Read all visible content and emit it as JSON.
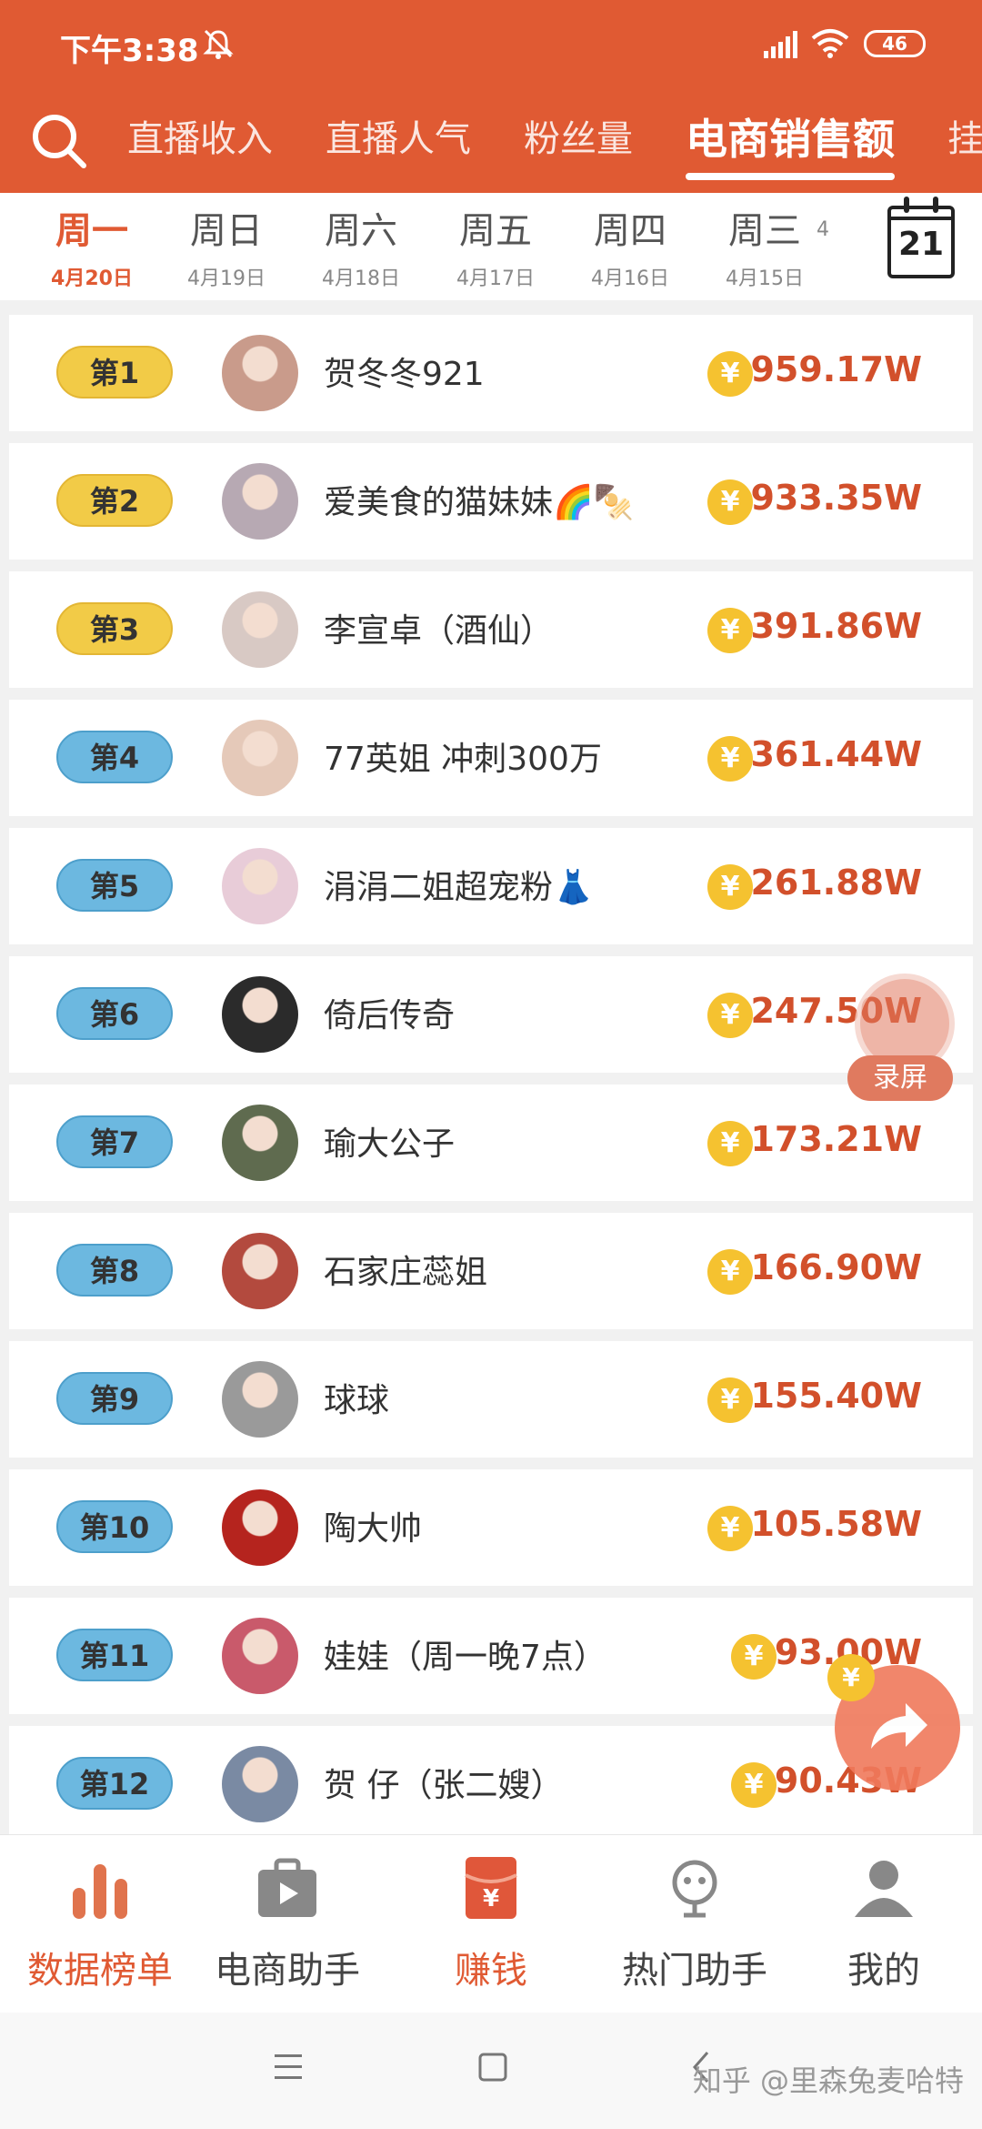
{
  "status": {
    "time": "下午3:38",
    "battery": "46"
  },
  "tabs": [
    {
      "label": "直播收入",
      "active": false
    },
    {
      "label": "直播人气",
      "active": false
    },
    {
      "label": "粉丝量",
      "active": false
    },
    {
      "label": "电商销售额",
      "active": true
    },
    {
      "label": "挂",
      "active": false
    }
  ],
  "days": [
    {
      "day": "周一",
      "date": "4月20日",
      "active": true
    },
    {
      "day": "周日",
      "date": "4月19日"
    },
    {
      "day": "周六",
      "date": "4月18日"
    },
    {
      "day": "周五",
      "date": "4月17日"
    },
    {
      "day": "周四",
      "date": "4月16日"
    },
    {
      "day": "周三",
      "date": "4月15日"
    },
    {
      "day": "",
      "date": "4"
    }
  ],
  "calendar": {
    "num": "21"
  },
  "rows": [
    {
      "rank": "第1",
      "name": "贺冬冬921",
      "amount": "959.17W",
      "tier": "gold",
      "avatar": "#c99b8b"
    },
    {
      "rank": "第2",
      "name": "爱美食的猫妹妹🌈🍢",
      "amount": "933.35W",
      "tier": "gold",
      "avatar": "#b7a9b3"
    },
    {
      "rank": "第3",
      "name": "李宣卓（酒仙）",
      "amount": "391.86W",
      "tier": "gold",
      "avatar": "#d8c9c4"
    },
    {
      "rank": "第4",
      "name": "77英姐 冲刺300万",
      "amount": "361.44W",
      "tier": "blue",
      "avatar": "#e5c9b9"
    },
    {
      "rank": "第5",
      "name": "涓涓二姐超宠粉👗",
      "amount": "261.88W",
      "tier": "blue",
      "avatar": "#e8ccd8"
    },
    {
      "rank": "第6",
      "name": "倚后传奇",
      "amount": "247.50W",
      "tier": "blue",
      "avatar": "#2b2b2b"
    },
    {
      "rank": "第7",
      "name": "瑜大公子",
      "amount": "173.21W",
      "tier": "blue",
      "avatar": "#5f6b4f"
    },
    {
      "rank": "第8",
      "name": "石家庄蕊姐",
      "amount": "166.90W",
      "tier": "blue",
      "avatar": "#b34a3e"
    },
    {
      "rank": "第9",
      "name": "球球",
      "amount": "155.40W",
      "tier": "blue",
      "avatar": "#9a9a9a"
    },
    {
      "rank": "第10",
      "name": "陶大帅",
      "amount": "105.58W",
      "tier": "blue",
      "avatar": "#b5241e"
    },
    {
      "rank": "第11",
      "name": "娃娃（周一晚7点）",
      "amount": "93.00W",
      "tier": "blue",
      "avatar": "#c95a6b"
    },
    {
      "rank": "第12",
      "name": "贺 仔（张二嫂）",
      "amount": "90.43W",
      "tier": "blue",
      "avatar": "#7a8aa3"
    }
  ],
  "coin_symbol": "¥",
  "floating": {
    "record_label": "录屏"
  },
  "bottom_nav": [
    {
      "label": "数据榜单",
      "active": true
    },
    {
      "label": "电商助手"
    },
    {
      "label": "赚钱"
    },
    {
      "label": "热门助手"
    },
    {
      "label": "我的"
    }
  ],
  "watermark": "知乎 @里森兔麦哈特"
}
